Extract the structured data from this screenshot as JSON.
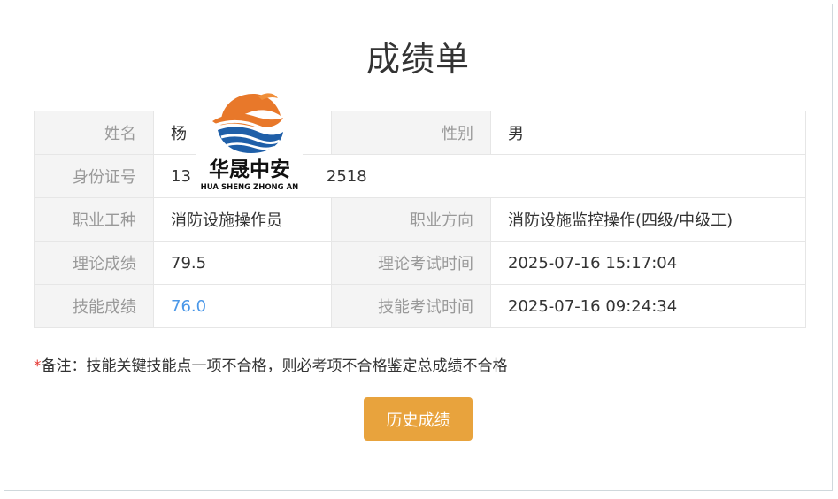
{
  "page": {
    "title": "成绩单"
  },
  "table": {
    "rows": [
      [
        {
          "label": "姓名",
          "value": "杨"
        },
        {
          "label": "性别",
          "value": "男"
        }
      ],
      [
        {
          "label": "身份证号",
          "value": "13",
          "value_tail": "2518"
        }
      ],
      [
        {
          "label": "职业工种",
          "value": "消防设施操作员"
        },
        {
          "label": "职业方向",
          "value": "消防设施监控操作(四级/中级工)"
        }
      ],
      [
        {
          "label": "理论成绩",
          "value": "79.5"
        },
        {
          "label": "理论考试时间",
          "value": "2025-07-16 15:17:04"
        }
      ],
      [
        {
          "label": "技能成绩",
          "value": "76.0"
        },
        {
          "label": "技能考试时间",
          "value": "2025-07-16 09:24:34"
        }
      ]
    ]
  },
  "note": {
    "asterisk": "*",
    "text": "备注：技能关键技能点一项不合格，则必考项不合格鉴定总成绩不合格"
  },
  "buttons": {
    "history_label": "历史成绩"
  },
  "watermark": {
    "name_cn": "华晟中安",
    "name_en": "HUA SHENG ZHONG AN"
  },
  "colors": {
    "accent_button": "#e8a33d",
    "skill_score": "#4a97e8",
    "label_bg": "#f4f4f4",
    "required_asterisk": "#e53935",
    "logo_orange": "#e8782a",
    "logo_blue": "#1f5fa8"
  }
}
